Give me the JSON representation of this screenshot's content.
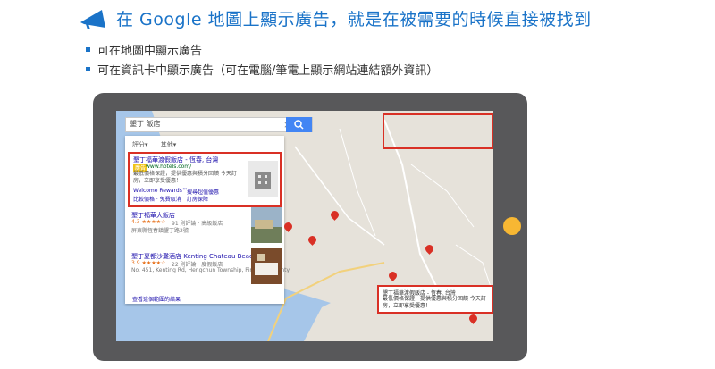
{
  "header": {
    "title": "在 Google 地圖上顯示廣告，就是在被需要的時候直接被找到"
  },
  "bullets": [
    "可在地圖中顯示廣告",
    "可在資訊卡中顯示廣告（可在電腦/筆電上顯示網站連結額外資訊）"
  ],
  "colors": {
    "accent": "#1a73c8",
    "highlight": "#d93025",
    "tablet": "#58585a",
    "home_button": "#f7b733",
    "search_button": "#4285f4"
  },
  "map": {
    "search": {
      "value": "墾丁 飯店"
    },
    "filters": [
      "評分▾",
      "其他▾"
    ],
    "results": [
      {
        "title": "墾丁福華渡假飯店 - 恆春, 台灣",
        "badge": "廣告",
        "url": "www.hotels.com/",
        "desc": "最低價格保證，提供優惠與積分回饋 今天訂房，立即享受優惠！",
        "links": [
          "Welcome Rewards™",
          "搜尋超值優惠",
          "比較價格 · 免費取消",
          "訂房保障"
        ]
      },
      {
        "title": "墾丁福華大飯店",
        "rating": "4.3 ★★★★☆",
        "meta": "91 則評論 · 高級飯店",
        "address": "屏東縣恆春鎮墾丁路2號"
      },
      {
        "title": "墾丁夏都沙灘酒店 Kenting Chateau Beach Resort",
        "rating": "3.9 ★★★★☆",
        "meta": "22 則評論 · 度假飯店",
        "address": "No. 451, Kenting Rd, Hengchun Township, Pingtung County"
      }
    ],
    "footer_link": "查看這個範圍的結果"
  },
  "icons": {
    "title": "megaphone-icon",
    "search": "magnifier-icon",
    "clear": "close-icon",
    "pin": "map-pin-icon"
  }
}
